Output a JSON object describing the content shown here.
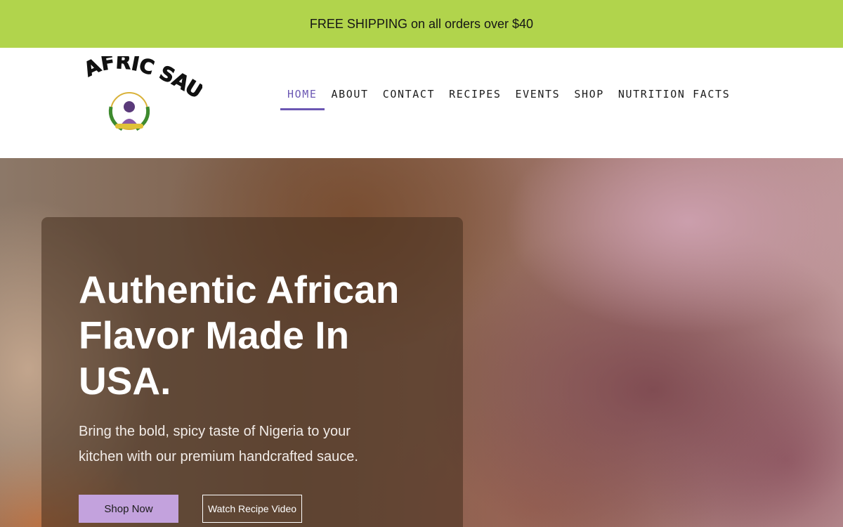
{
  "announcement": {
    "text": "FREE SHIPPING on all orders over $40"
  },
  "logo": {
    "wordmark": "AFRIC SAUCE",
    "emblem": "Chef PED's Kitchen"
  },
  "nav": {
    "items": [
      {
        "label": "HOME",
        "active": true
      },
      {
        "label": "ABOUT",
        "active": false
      },
      {
        "label": "CONTACT",
        "active": false
      },
      {
        "label": "RECIPES",
        "active": false
      },
      {
        "label": "EVENTS",
        "active": false
      },
      {
        "label": "SHOP",
        "active": false
      },
      {
        "label": "NUTRITION FACTS",
        "active": false
      }
    ]
  },
  "hero": {
    "title": "Authentic African Flavor Made In USA.",
    "subtitle": "Bring the bold, spicy taste of Nigeria to your kitchen with our premium handcrafted sauce.",
    "primary_button": "Shop Now",
    "secondary_button": "Watch Recipe Video"
  },
  "colors": {
    "announcement_bg": "#b1d44c",
    "accent_purple": "#6b57b3",
    "button_purple": "#c3a2dd"
  }
}
